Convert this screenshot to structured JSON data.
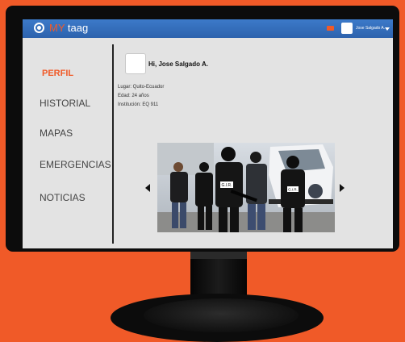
{
  "app": {
    "logo_my": "MY",
    "logo_taag": "taag",
    "user_name": "Jose Salgado A."
  },
  "nav": {
    "items": [
      {
        "label": "PERFIL",
        "active": true
      },
      {
        "label": "HISTORIAL",
        "active": false
      },
      {
        "label": "MAPAS",
        "active": false
      },
      {
        "label": "EMERGENCIAS",
        "active": false
      },
      {
        "label": "NOTICIAS",
        "active": false
      }
    ]
  },
  "profile": {
    "greeting": "Hi, Jose Salgado A.",
    "lugar": "Lugar: Quito-Ecuador",
    "edad": "Edad: 24 años",
    "institucion": "Institución: EQ 911"
  },
  "photo": {
    "patch_1": "G.I.R.",
    "patch_2": "G.I.R."
  },
  "icons": {
    "logo": "taag-logo-icon",
    "notification": "notification-icon",
    "caret": "chevron-down-icon",
    "prev": "arrow-left-icon",
    "next": "arrow-right-icon"
  },
  "colors": {
    "background": "#f05a28",
    "topbar": "#3570b8",
    "accent": "#f05a28",
    "screen": "#e3e3e3",
    "bezel": "#0c0c0c"
  }
}
